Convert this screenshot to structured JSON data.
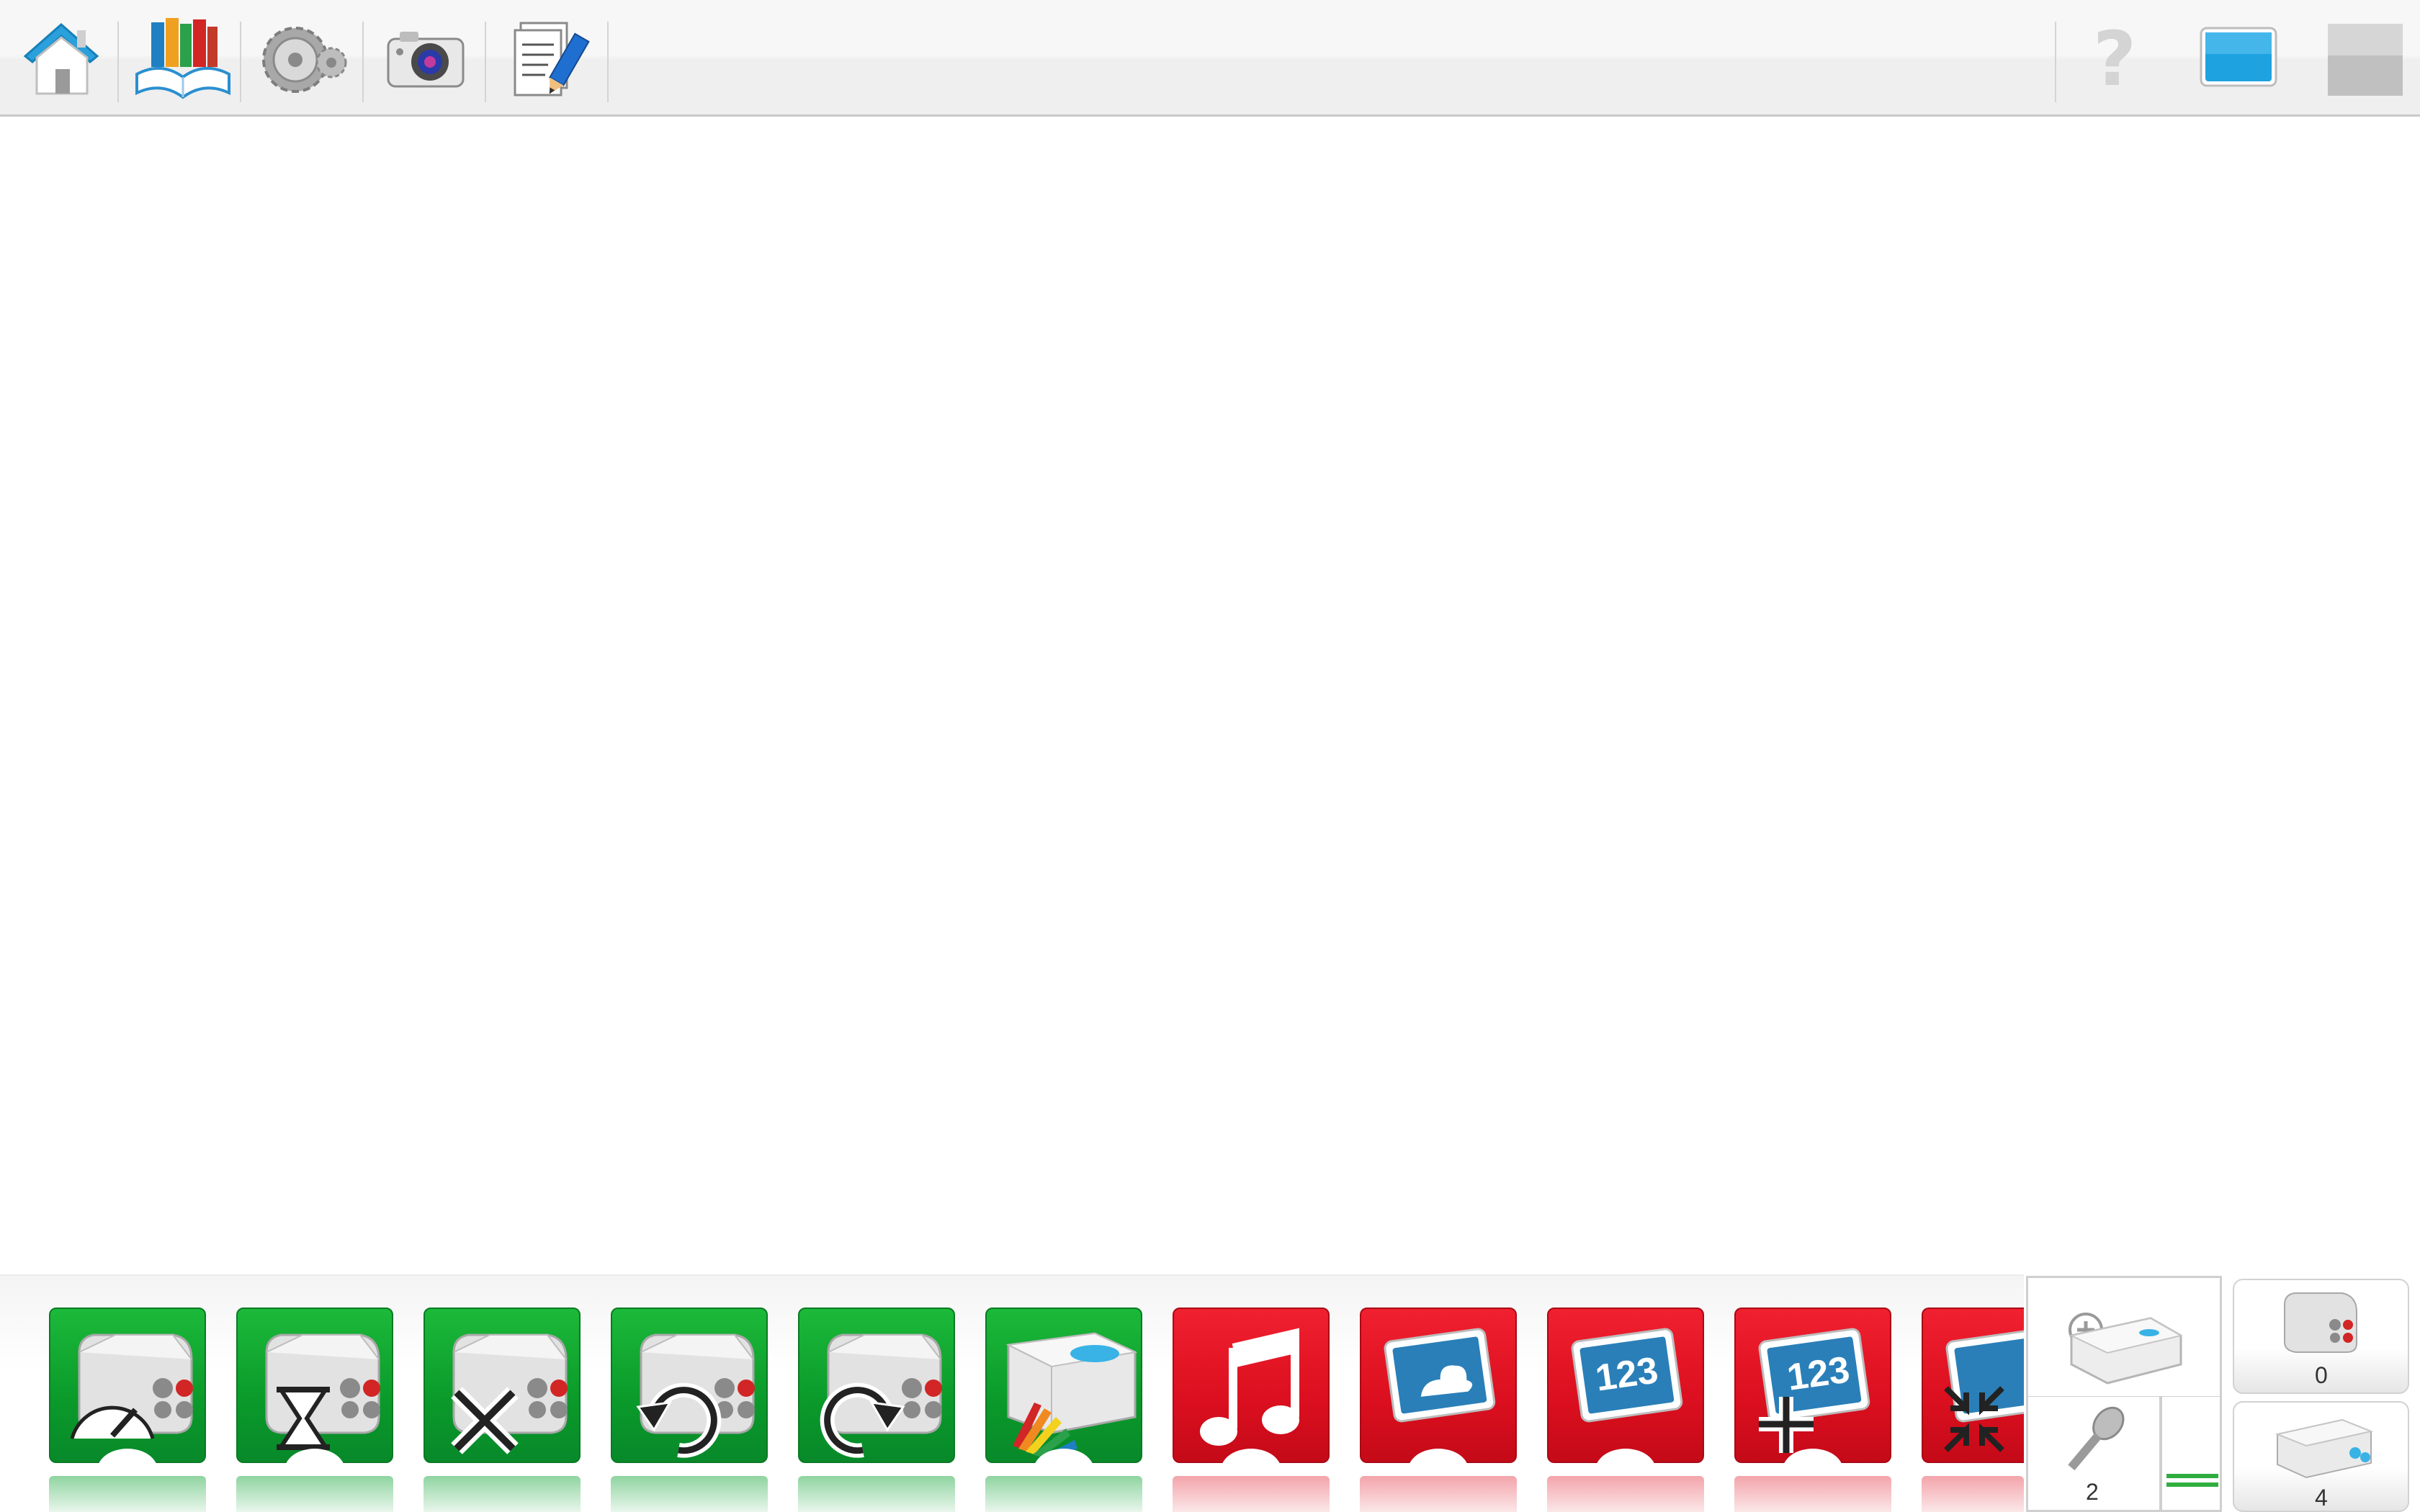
{
  "toolbar": {
    "left_buttons": [
      {
        "name": "home",
        "icon": "home-icon"
      },
      {
        "name": "library",
        "icon": "books-icon"
      },
      {
        "name": "settings",
        "icon": "gears-icon"
      },
      {
        "name": "camera",
        "icon": "camera-icon"
      },
      {
        "name": "documentation",
        "icon": "document-pencil-icon"
      }
    ],
    "right_buttons": [
      {
        "name": "help",
        "icon": "question-mark-icon",
        "label": "?"
      },
      {
        "name": "display",
        "icon": "tablet-screen-icon"
      },
      {
        "name": "stop",
        "icon": "stop-square-icon"
      }
    ]
  },
  "palette": {
    "blocks": [
      {
        "color": "green",
        "icon": "motor-power-icon"
      },
      {
        "color": "green",
        "icon": "motor-on-for-time-icon"
      },
      {
        "color": "green",
        "icon": "motor-off-icon"
      },
      {
        "color": "green",
        "icon": "motor-counterclockwise-icon"
      },
      {
        "color": "green",
        "icon": "motor-clockwise-icon"
      },
      {
        "color": "green",
        "icon": "hub-light-color-icon"
      },
      {
        "color": "red",
        "icon": "play-sound-icon"
      },
      {
        "color": "red",
        "icon": "display-background-icon"
      },
      {
        "color": "red",
        "icon": "display-number-icon",
        "label": "123"
      },
      {
        "color": "red",
        "icon": "display-add-number-icon",
        "label": "123"
      },
      {
        "color": "red",
        "icon": "display-shrink-icon"
      }
    ]
  },
  "devices": {
    "motor_count": "0",
    "mic_count": "2",
    "tilt_count": "4"
  },
  "colors": {
    "green_block": "#0a9a2a",
    "red_block": "#db0f1f",
    "screen_blue": "#2a7fb8"
  }
}
